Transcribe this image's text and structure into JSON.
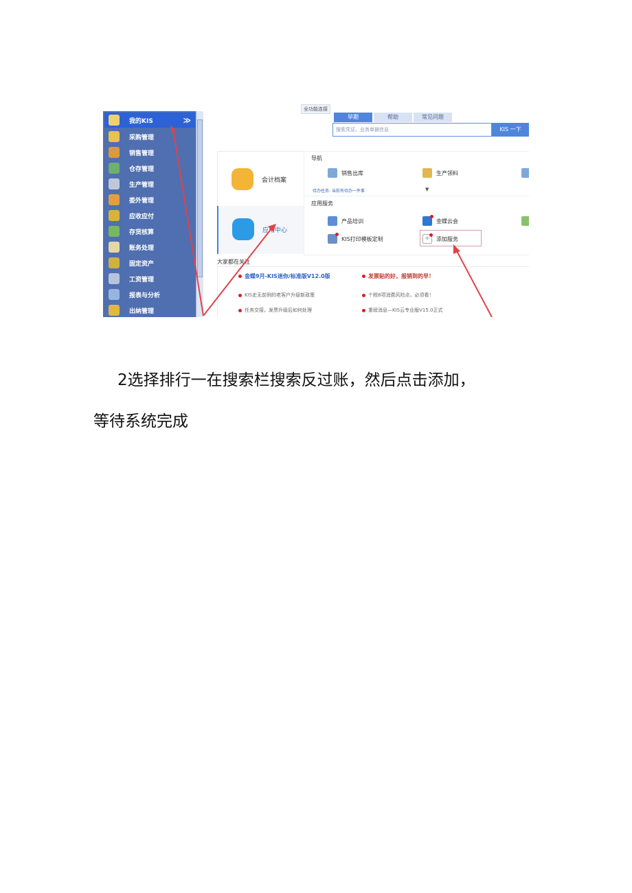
{
  "sidebar": {
    "items": [
      {
        "label": "我的KIS",
        "icon": "my-kis-icon"
      },
      {
        "label": "采购管理",
        "icon": "purchase-icon"
      },
      {
        "label": "销售管理",
        "icon": "sales-icon"
      },
      {
        "label": "仓存管理",
        "icon": "warehouse-icon"
      },
      {
        "label": "生产管理",
        "icon": "production-icon"
      },
      {
        "label": "委外管理",
        "icon": "outsource-icon"
      },
      {
        "label": "应收应付",
        "icon": "receivable-icon"
      },
      {
        "label": "存货核算",
        "icon": "inventory-icon"
      },
      {
        "label": "账务处理",
        "icon": "accounting-icon"
      },
      {
        "label": "固定资产",
        "icon": "fixed-asset-icon"
      },
      {
        "label": "工资管理",
        "icon": "salary-icon"
      },
      {
        "label": "报表与分析",
        "icon": "report-icon"
      },
      {
        "label": "出纳管理",
        "icon": "cashier-icon"
      }
    ],
    "expand_glyph": "≫"
  },
  "header": {
    "caption": "全功能连接",
    "tabs": [
      "早期",
      "帮助",
      "常见问题"
    ],
    "search_placeholder": "搜索凭证、业务单据信息",
    "search_button": "KIS 一下"
  },
  "cards": {
    "accounting": "会计档案",
    "app_center": "应用中心"
  },
  "nav": {
    "title": "导航",
    "items": [
      "销售出库",
      "生产领料"
    ],
    "todo": "待办任务: 当前有待办一件事",
    "services_title": "应用服务",
    "services": [
      "产品培训",
      "金蝶云会",
      "KIS打印模板定制",
      "添加服务"
    ]
  },
  "focus": {
    "title": "大家都在关注",
    "news_left_head": "金蝶9月-KIS迷你/标准版V12.0版",
    "news_left_1": "KIS史无前例的老客户升级新政策",
    "news_left_2": "任务交接，发票升级后如何处理",
    "news_right_head": "发票贴的好，报销到的早！",
    "news_right_1": "个税8项消费风险点，必须看！",
    "news_right_2": "重磅消息—KIS云专业版V15.0正式"
  },
  "text": {
    "line1": "2选择排行一在搜索栏搜索反过账，然后点击添加，",
    "line2": "等待系统完成"
  },
  "colors": {
    "sidebar_bg": "#4f6fb0",
    "sidebar_active": "#2c62d6",
    "accent_blue": "#4f86dc",
    "annotation_red": "#e0424a"
  }
}
